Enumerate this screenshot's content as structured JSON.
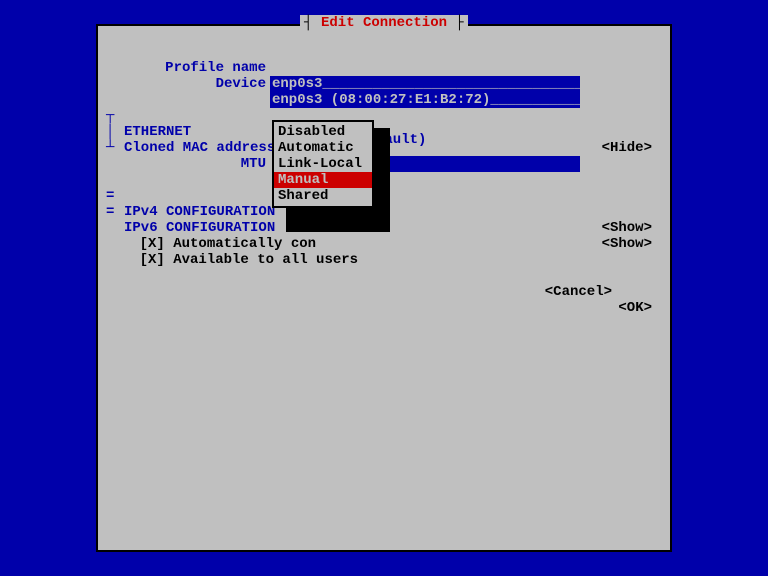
{
  "title_open": "┤ ",
  "title": "Edit Connection",
  "title_close": " ├",
  "labels": {
    "profile": "Profile name",
    "device": "Device",
    "ethernet": "ETHERNET",
    "cloned": "Cloned MAC address",
    "mtu": "MTU",
    "ipv4": "IPv4 CONFIGURATION",
    "ipv6": "IPv6 CONFIGURATION"
  },
  "values": {
    "profile": "enp0s3__________________________________",
    "device": "enp0s3 (08:00:27:E1:B2:72)______________",
    "cloned": "",
    "mtu_visible": "fault)"
  },
  "actions": {
    "hide": "<Hide>",
    "show": "<Show>",
    "cancel": "<Cancel>",
    "ok": "<OK>"
  },
  "checks": {
    "auto": "[X] Automatically con",
    "avail": "[X] Available to all users"
  },
  "dropdown": {
    "items": [
      "Disabled",
      "Automatic",
      "Link-Local",
      "Manual",
      "Shared"
    ],
    "selected": "Manual"
  },
  "glyph": {
    "pipe": "│",
    "top": "┬",
    "bot": "┴",
    "eq": "="
  }
}
